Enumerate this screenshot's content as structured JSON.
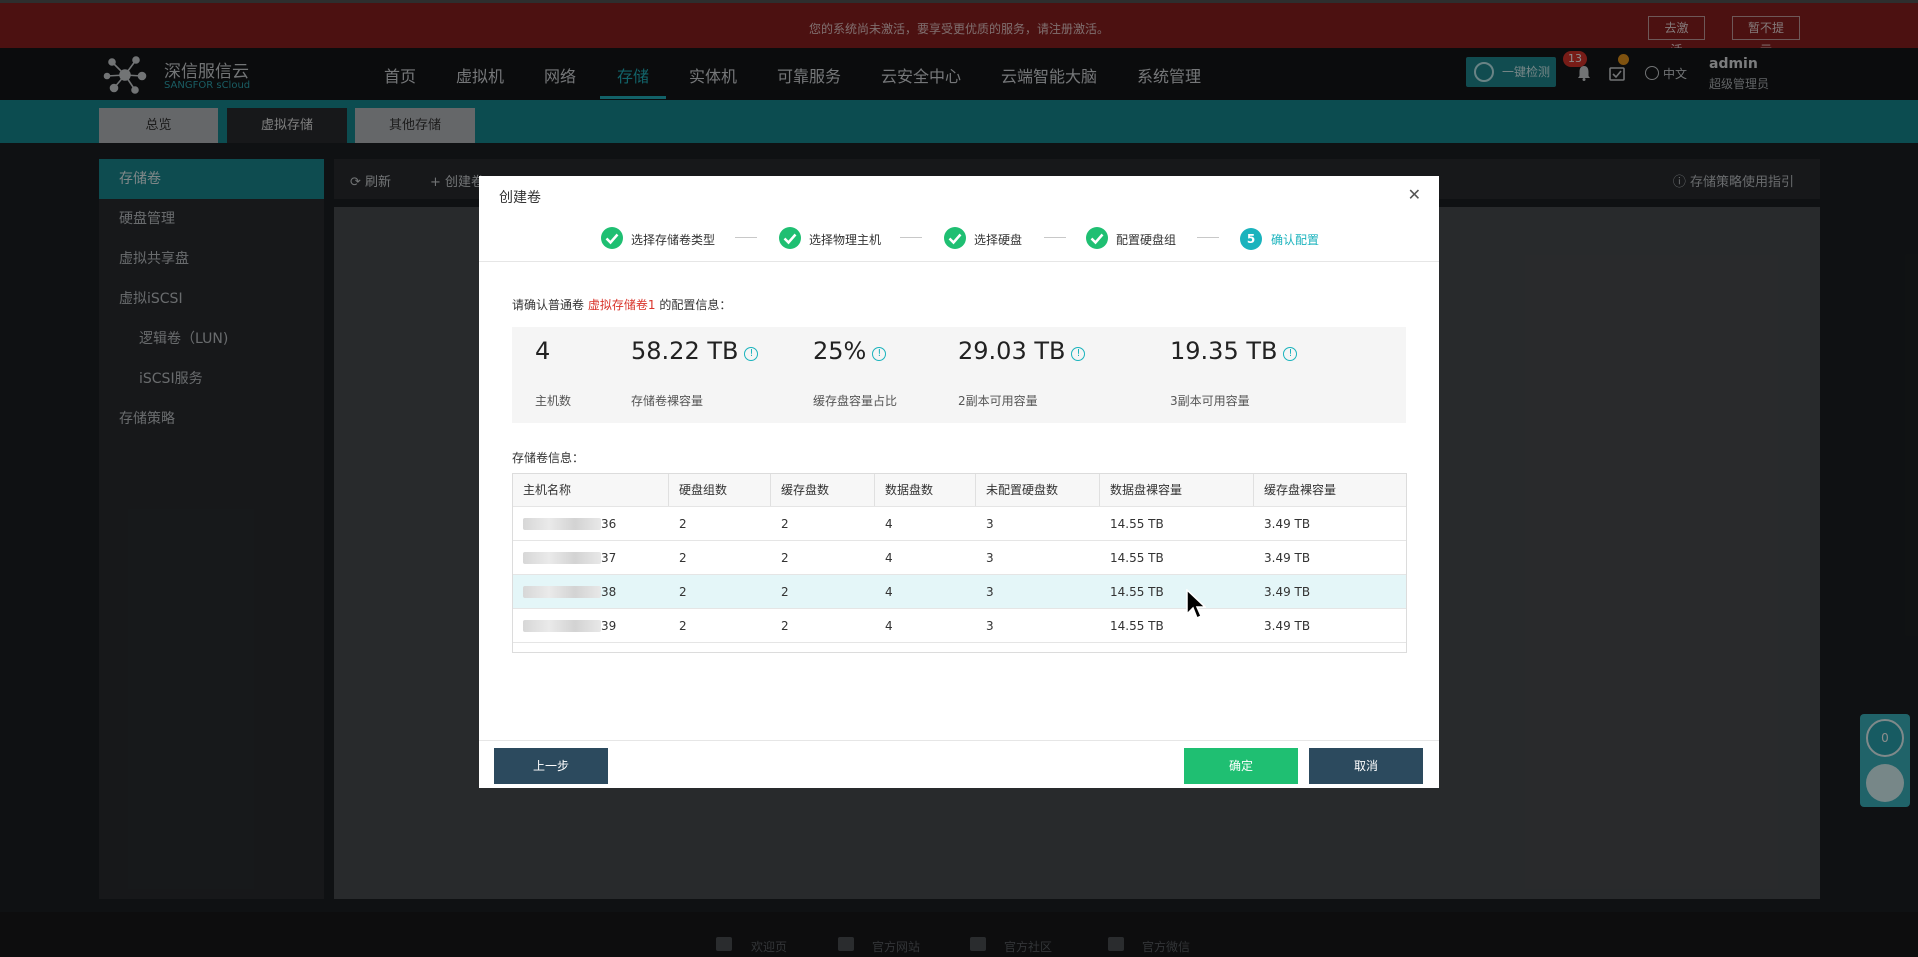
{
  "banner": {
    "message": "您的系统尚未激活，要享受更优质的服务，请注册激活。",
    "activate_label": "去激活",
    "dismiss_label": "暂不提示"
  },
  "brand": {
    "name": "深信服信云",
    "sub": "SANGFOR sCloud"
  },
  "nav": {
    "items": [
      "首页",
      "虚拟机",
      "网络",
      "存储",
      "实体机",
      "可靠服务",
      "云安全中心",
      "云端智能大脑",
      "系统管理"
    ],
    "active": "存储"
  },
  "header": {
    "check_label": "一键检测",
    "notif_count": "13",
    "lang": "中文",
    "user_name": "admin",
    "user_role": "超级管理员"
  },
  "subtabs": [
    "总览",
    "虚拟存储",
    "其他存储"
  ],
  "sidebar": {
    "items": [
      "存储卷",
      "硬盘管理",
      "虚拟共享盘",
      "虚拟iSCSI",
      "逻辑卷（LUN)",
      "iSCSI服务",
      "存储策略"
    ]
  },
  "toolbar": {
    "refresh": "刷新",
    "create": "创建卷",
    "guide": "存储策略使用指引"
  },
  "footer": {
    "links": [
      "欢迎页",
      "官方网站",
      "官方社区",
      "官方微信"
    ]
  },
  "float": {
    "count": "0"
  },
  "modal": {
    "title": "创建卷",
    "steps": [
      "选择存储卷类型",
      "选择物理主机",
      "选择硬盘",
      "配置硬盘组",
      "确认配置"
    ],
    "current_step_num": "5",
    "confirm_prefix": "请确认普通卷",
    "volume_name": "虚拟存储卷1",
    "confirm_suffix": "的配置信息：",
    "stats": [
      {
        "value": "4",
        "label": "主机数"
      },
      {
        "value": "58.22 TB",
        "label": "存储卷裸容量"
      },
      {
        "value": "25%",
        "label": "缓存盘容量占比"
      },
      {
        "value": "29.03 TB",
        "label": "2副本可用容量"
      },
      {
        "value": "19.35 TB",
        "label": "3副本可用容量"
      }
    ],
    "section_label": "存储卷信息：",
    "table": {
      "headers": [
        "主机名称",
        "硬盘组数",
        "缓存盘数",
        "数据盘数",
        "未配置硬盘数",
        "数据盘裸容量",
        "缓存盘裸容量"
      ],
      "rows": [
        [
          "36",
          "2",
          "2",
          "4",
          "3",
          "14.55 TB",
          "3.49 TB"
        ],
        [
          "37",
          "2",
          "2",
          "4",
          "3",
          "14.55 TB",
          "3.49 TB"
        ],
        [
          "38",
          "2",
          "2",
          "4",
          "3",
          "14.55 TB",
          "3.49 TB"
        ],
        [
          "39",
          "2",
          "2",
          "4",
          "3",
          "14.55 TB",
          "3.49 TB"
        ]
      ],
      "highlighted_row": 2
    },
    "prev_label": "上一步",
    "ok_label": "确定",
    "cancel_label": "取消"
  },
  "colors": {
    "accent": "#1ab3bd",
    "danger": "#d9342b",
    "success": "#1fbf72",
    "dark_button": "#2c4a5e"
  }
}
